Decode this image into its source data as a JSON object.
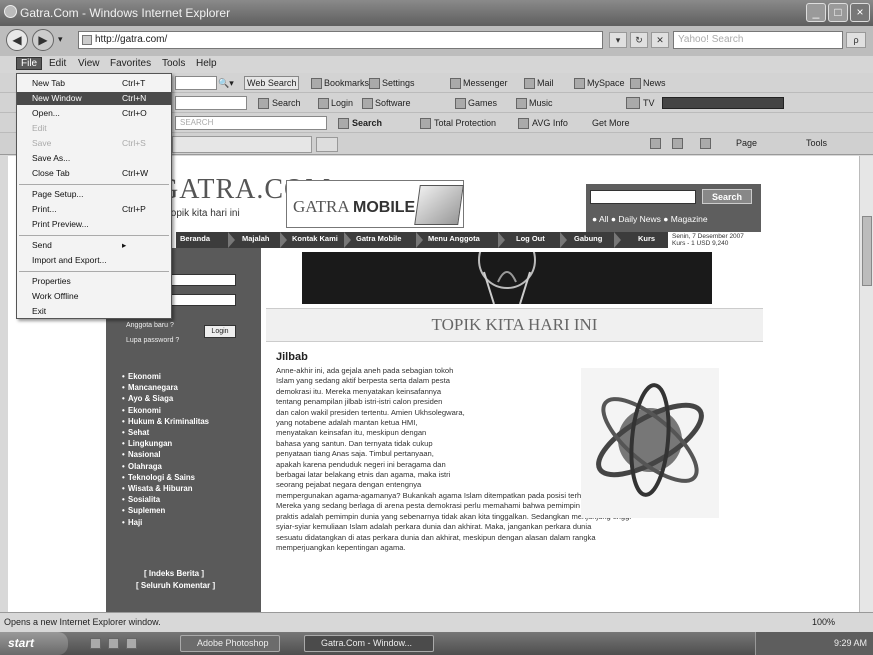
{
  "window": {
    "title": "Gatra.Com - Windows Internet Explorer",
    "minimize_label": "_",
    "maximize_label": "□",
    "close_label": "×"
  },
  "address_bar": {
    "back_label": "◀",
    "forward_label": "▶",
    "url": "http://gatra.com/",
    "search_placeholder": "Yahoo! Search",
    "go_label": "▾",
    "refresh_label": "↻",
    "stop_label": "✕",
    "search_btn_label": "ρ"
  },
  "menu_bar": {
    "items": [
      "File",
      "Edit",
      "View",
      "Favorites",
      "Tools",
      "Help"
    ]
  },
  "file_menu": {
    "items": [
      {
        "label": "New Tab",
        "shortcut": "Ctrl+T",
        "disabled": false,
        "highlighted": false
      },
      {
        "label": "New Window",
        "shortcut": "Ctrl+N",
        "disabled": false,
        "highlighted": true
      },
      {
        "label": "Open...",
        "shortcut": "Ctrl+O",
        "disabled": false,
        "highlighted": false
      },
      {
        "label": "Edit",
        "shortcut": "",
        "disabled": true,
        "highlighted": false
      },
      {
        "label": "Save",
        "shortcut": "Ctrl+S",
        "disabled": true,
        "highlighted": false
      },
      {
        "label": "Save As...",
        "shortcut": "",
        "disabled": false,
        "highlighted": false
      },
      {
        "label": "Close Tab",
        "shortcut": "Ctrl+W",
        "disabled": false,
        "highlighted": false
      },
      {
        "label": "Page Setup...",
        "shortcut": "",
        "disabled": false,
        "highlighted": false
      },
      {
        "label": "Print...",
        "shortcut": "Ctrl+P",
        "disabled": false,
        "highlighted": false
      },
      {
        "label": "Print Preview...",
        "shortcut": "",
        "disabled": false,
        "highlighted": false
      },
      {
        "label": "Send",
        "shortcut": "▸",
        "disabled": false,
        "highlighted": false
      },
      {
        "label": "Import and Export...",
        "shortcut": "",
        "disabled": false,
        "highlighted": false
      },
      {
        "label": "Properties",
        "shortcut": "",
        "disabled": false,
        "highlighted": false
      },
      {
        "label": "Work Offline",
        "shortcut": "",
        "disabled": false,
        "highlighted": false
      },
      {
        "label": "Exit",
        "shortcut": "",
        "disabled": false,
        "highlighted": false
      }
    ]
  },
  "toolbar1": {
    "web_search": "Web Search",
    "bookmarks": "Bookmarks",
    "settings": "Settings",
    "messenger": "Messenger",
    "mail": "Mail",
    "myspace": "MySpace",
    "news": "News"
  },
  "toolbar2": {
    "search": "Search",
    "login": "Login",
    "software": "Software",
    "games": "Games",
    "music": "Music",
    "tv": "TV"
  },
  "toolbar3": {
    "search_placeholder": "SEARCH",
    "search_btn": "Search",
    "total_protection": "Total Protection",
    "avg_info": "AVG Info",
    "get_more": "Get More"
  },
  "command_bar": {
    "page": "Page",
    "tools": "Tools"
  },
  "site": {
    "logo": "GATRA.COM",
    "slogan": "topik kita hari ini",
    "mobile_text_1": "GATRA ",
    "mobile_text_2": "MOBILE",
    "search_button": "Search",
    "search_options": "● All  ● Daily News  ● Magazine",
    "nav": [
      "Beranda",
      "Majalah",
      "Kontak Kami",
      "Gatra Mobile",
      "Menu Anggota",
      "Log Out",
      "Gabung",
      "Kurs"
    ],
    "date_line1": "Senin, 7 Desember 2007",
    "date_line2": "Kurs - 1 USD 9,240",
    "login_text_1": "Anggota baru ?",
    "login_button": "Login",
    "login_text_2": "Lupa password ?",
    "topik_heading": "TOPIK KITA HARI INI",
    "article_title": "Jilbab",
    "article_lines_narrow": [
      "Anne-akhir ini, ada gejala aneh pada sebagian tokoh",
      "Islam yang sedang aktif berpesta serta dalam pesta",
      "demokrasi itu. Mereka menyatakan keinsafannya",
      "tentang penampilan jilbab istri-istri calon presiden",
      "dan calon wakil presiden tertentu. Amien Ukhsolegwara,",
      "yang notabene adalah mantan ketua HMI,",
      "menyatakan keinsafan itu, meskipun dengan",
      "bahasa yang santun. Dan ternyata tidak cukup",
      "penyataan tiang Anas saja. Timbul pertanyaan,",
      "apakah karena penduduk negeri ini beragama dan",
      "berbagai latar belakang etnis dan agama, maka istri",
      "seorang pejabat negara dengan entengnya"
    ],
    "article_lines_wide": [
      "mempergunakan agama-agamanya? Bukankah agama Islam ditempatkan pada posisi terhormat?",
      "Mereka yang sedang berlaga di arena pesta demokrasi perlu memahami bahwa pemimpin politik",
      "praktis adalah pemimpin dunia yang sebenarnya tidak akan kita tinggalkan. Sedangkan menjunjung tinggi",
      "syiar-syiar kemuliaan Islam adalah perkara dunia dan akhirat. Maka, jangankan perkara dunia",
      "sesuatu didatangkan di atas perkara dunia dan akhirat, meskipun dengan alasan dalam rangka",
      "memperjuangkan kepentingan agama."
    ],
    "categories": [
      "Ekonomi",
      "Mancanegara",
      "Ayo & Siaga",
      "Ekonomi",
      "Hukum & Kriminalitas",
      "Sehat",
      "Lingkungan",
      "Nasional",
      "Olahraga",
      "Teknologi & Sains",
      "Wisata & Hiburan",
      "Sosialita",
      "Suplemen",
      "Haji"
    ],
    "indeks_berita": "[ Indeks Berita ]",
    "seluruh_komentar": "[ Seluruh Komentar ]"
  },
  "status_bar": {
    "text": "Opens a new Internet Explorer window.",
    "zoom": "100%"
  },
  "taskbar": {
    "start": "start",
    "tasks": [
      "Adobe Photoshop",
      "Gatra.Com - Window..."
    ],
    "clock": "9:29 AM"
  }
}
